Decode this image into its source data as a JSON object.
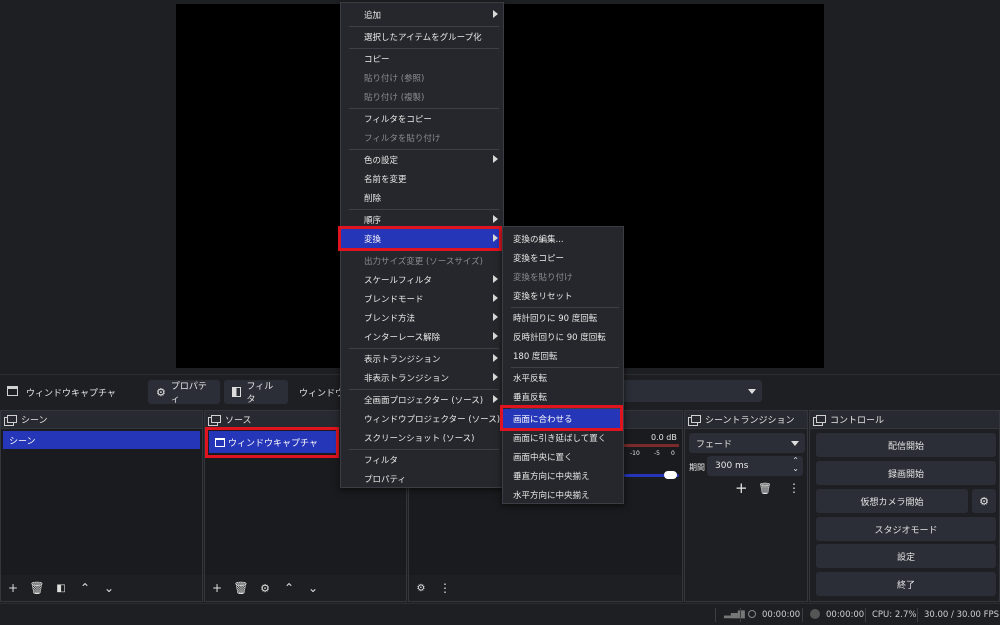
{
  "source_toolbar": {
    "source_name": "ウィンドウキャプチャ",
    "properties_label": "プロパティ",
    "filters_label": "フィルタ",
    "window_label": "ウィンドウ"
  },
  "docks": {
    "scenes": {
      "title": "シーン",
      "items": [
        "シーン"
      ]
    },
    "sources": {
      "title": "ソース",
      "items": [
        "ウィンドウキャプチャ"
      ]
    },
    "audio_mixer": {
      "db_value": "0.0 dB",
      "scale": [
        "-10",
        "-5",
        "0"
      ]
    },
    "transitions": {
      "title": "シーントランジション",
      "type": "フェード",
      "duration_label": "期間",
      "duration_value": "300 ms"
    },
    "controls": {
      "title": "コントロール",
      "start_streaming": "配信開始",
      "start_recording": "録画開始",
      "start_virtual_camera": "仮想カメラ開始",
      "studio_mode": "スタジオモード",
      "settings": "設定",
      "exit": "終了"
    }
  },
  "context_menu": {
    "add": "追加",
    "group_selected": "選択したアイテムをグループ化",
    "copy": "コピー",
    "paste_reference": "貼り付け (参照)",
    "paste_duplicate": "貼り付け (複製)",
    "copy_filters": "フィルタをコピー",
    "paste_filters": "フィルタを貼り付け",
    "color_settings": "色の設定",
    "rename": "名前を変更",
    "remove": "削除",
    "order": "順序",
    "transform": "変換",
    "resize_output": "出力サイズ変更 (ソースサイズ)",
    "scale_filtering": "スケールフィルタ",
    "blend_mode": "ブレンドモード",
    "blend_method": "ブレンド方法",
    "deinterlacing": "インターレース解除",
    "show_transition": "表示トランジション",
    "hide_transition": "非表示トランジション",
    "fullscreen_projector": "全画面プロジェクター (ソース)",
    "windowed_projector": "ウィンドウプロジェクター (ソース)",
    "screenshot": "スクリーンショット (ソース)",
    "filters": "フィルタ",
    "properties": "プロパティ"
  },
  "transform_submenu": {
    "edit_transform": "変換の編集...",
    "copy_transform": "変換をコピー",
    "paste_transform": "変換を貼り付け",
    "reset_transform": "変換をリセット",
    "rotate_cw": "時計回りに 90 度回転",
    "rotate_ccw": "反時計回りに 90 度回転",
    "rotate_180": "180 度回転",
    "flip_horizontal": "水平反転",
    "flip_vertical": "垂直反転",
    "fit_to_screen": "画面に合わせる",
    "stretch_to_screen": "画面に引き延ばして置く",
    "center_to_screen": "画面中央に置く",
    "center_vertically": "垂直方向に中央揃え",
    "center_horizontally": "水平方向に中央揃え"
  },
  "status_bar": {
    "rec_time": "00:00:00",
    "stream_time": "00:00:00",
    "cpu": "CPU: 2.7%",
    "fps": "30.00 / 30.00 FPS"
  },
  "colors": {
    "accent": "#2536b8",
    "highlight_border": "#e0141e"
  }
}
